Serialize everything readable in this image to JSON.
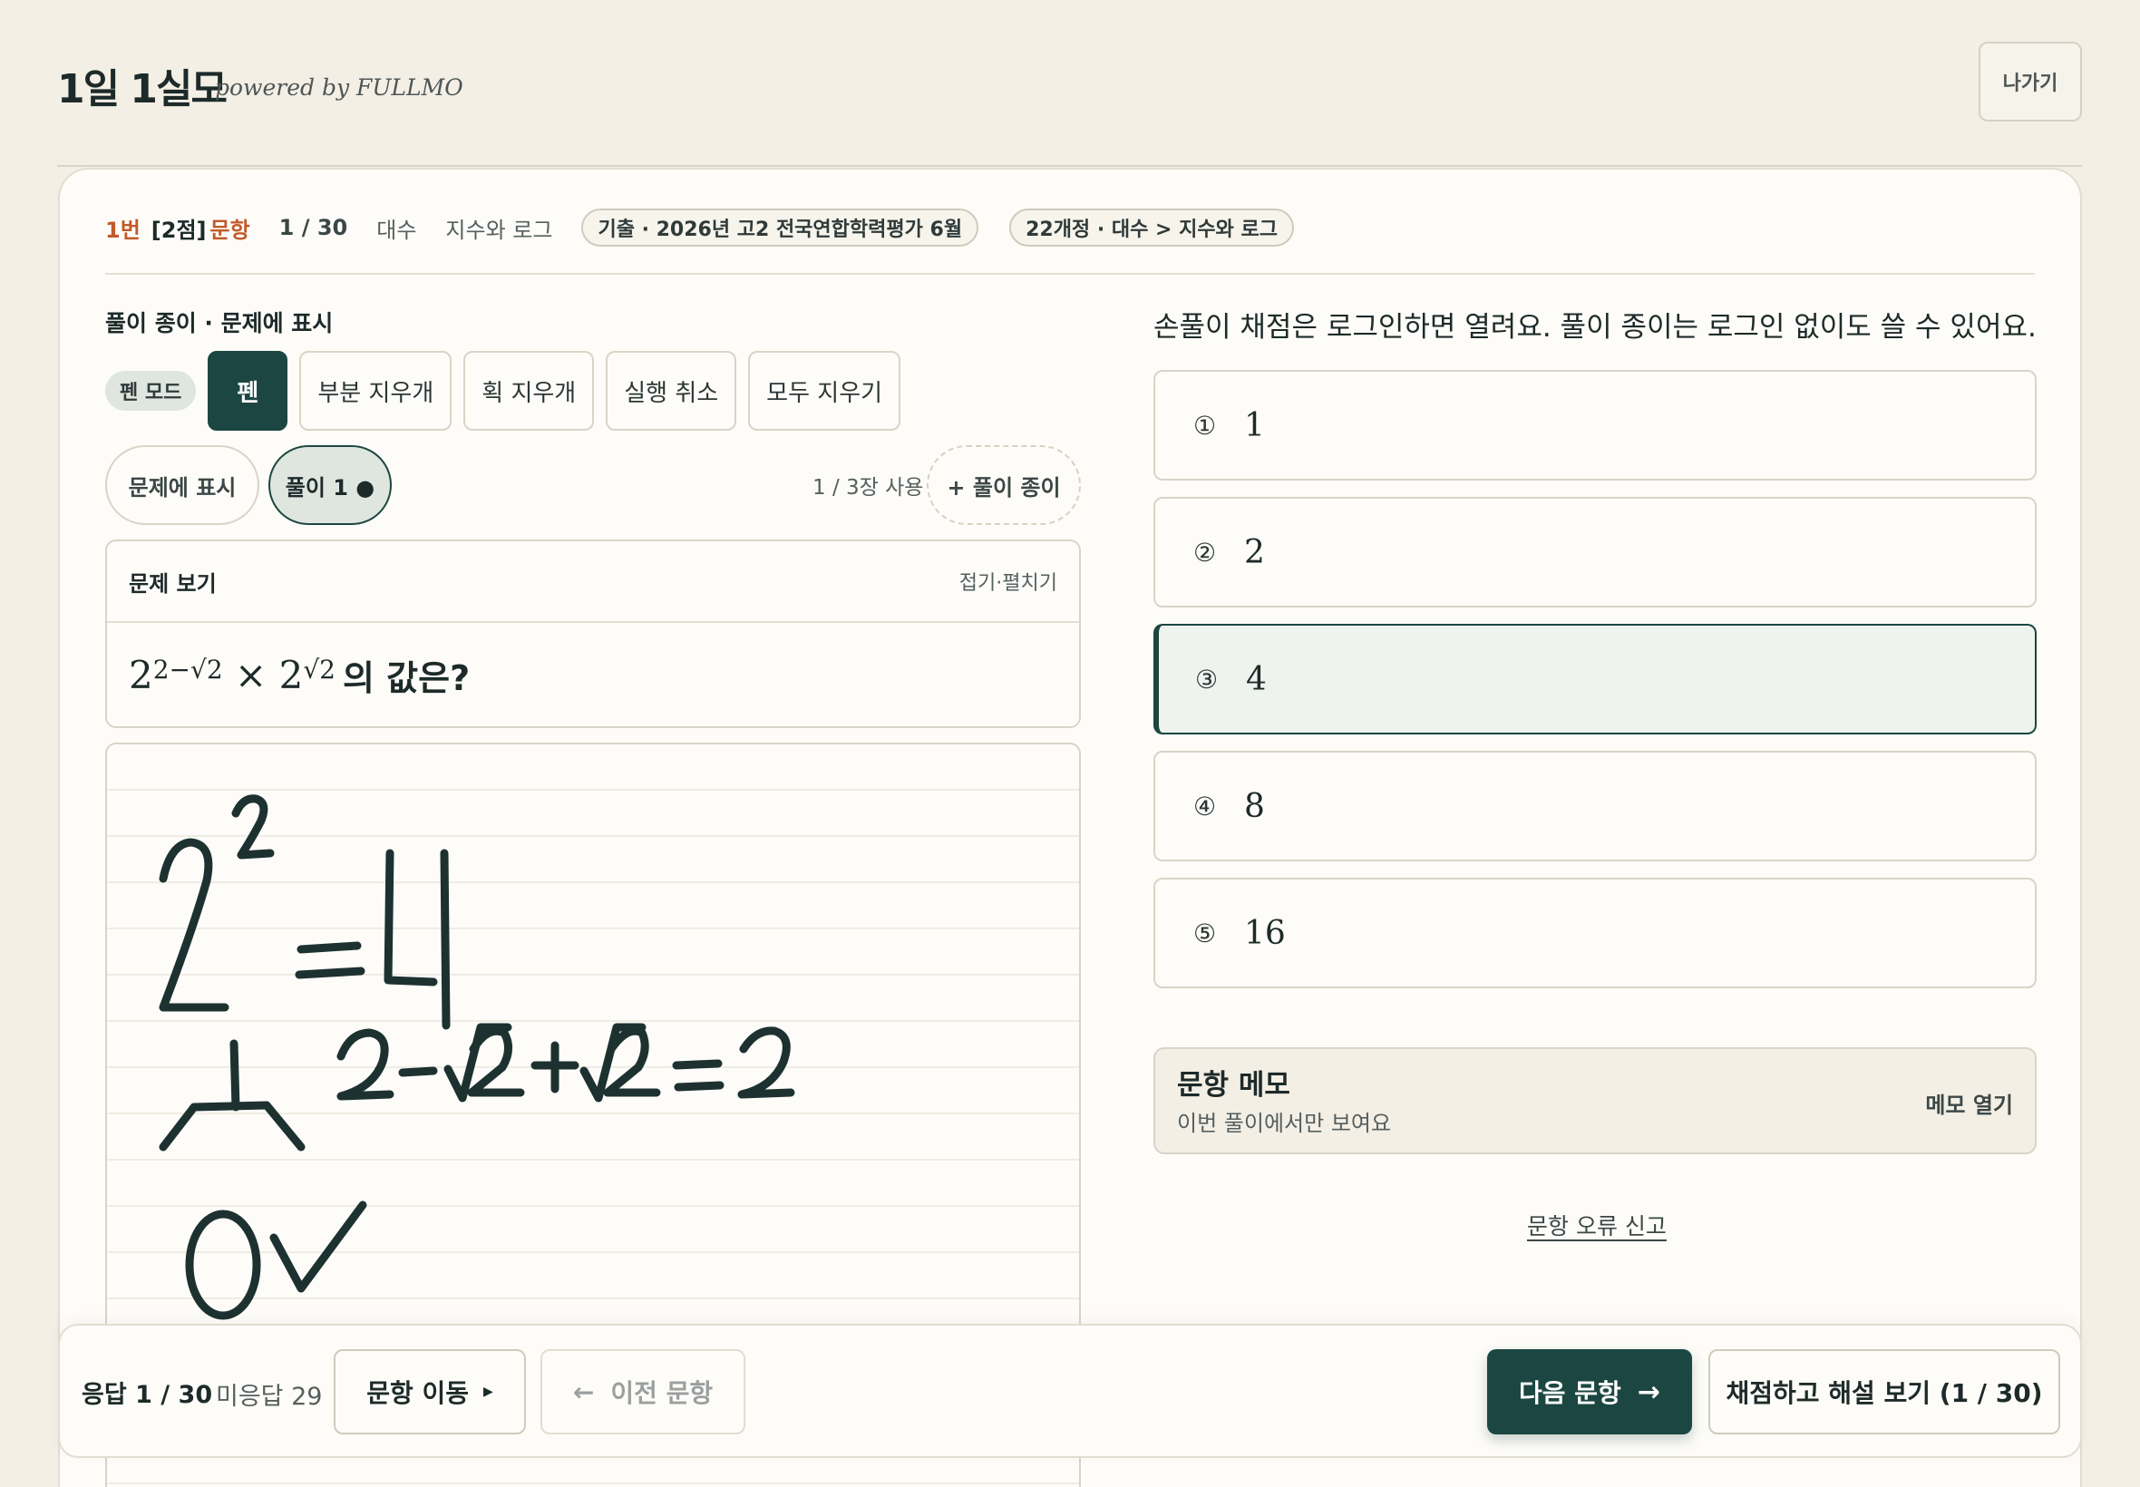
{
  "header": {
    "title": "1일 1실모",
    "powered_by": "powered by FULLMO",
    "exit_label": "나가기"
  },
  "question_meta": {
    "number": "1번",
    "points": "[2점]",
    "kind": "문항",
    "count": "1 / 30",
    "subject": "대수",
    "unit": "지수와 로그",
    "source_chip": "기출 · 2026년 고2 전국연합학력평가 6월",
    "curriculum_chip": "22개정 · 대수 > 지수와 로그"
  },
  "paper": {
    "title": "풀이 종이 · 문제에 표시",
    "pen_mode_label": "펜 모드",
    "tools": {
      "pen": "펜",
      "partial_eraser": "부분 지우개",
      "stroke_eraser": "획 지우개",
      "undo": "실행 취소",
      "clear_all": "모두 지우기"
    },
    "sheet_show_on_problem": "문제에 표시",
    "sheet_solution": "풀이 1 ●",
    "sheet_usage": "1 / 3장 사용",
    "add_sheet": "+ 풀이 종이"
  },
  "problem": {
    "header": "문제 보기",
    "toggle": "접기·펼치기",
    "base1": "2",
    "exp1": "2−√2",
    "times": " × ",
    "base2": "2",
    "exp2": "√2",
    "suffix": "의 값은?"
  },
  "right_panel": {
    "login_note": "손풀이 채점은 로그인하면 열려요. 풀이 종이는 로그인 없이도 쓸 수 있어요."
  },
  "options": [
    {
      "mark": "①",
      "value": "1"
    },
    {
      "mark": "②",
      "value": "2"
    },
    {
      "mark": "③",
      "value": "4"
    },
    {
      "mark": "④",
      "value": "8"
    },
    {
      "mark": "⑤",
      "value": "16"
    }
  ],
  "memo": {
    "title": "문항 메모",
    "subtitle": "이번 풀이에서만 보여요",
    "open_label": "메모 열기"
  },
  "report_label": "문항 오류 신고",
  "bottom": {
    "answered": "응답 1 / 30",
    "unanswered": "미응답 29",
    "move_label": "문항 이동",
    "prev_label": "이전 문항",
    "next_label": "다음 문항",
    "grade_label": "채점하고 해설 보기 (1 / 30)"
  },
  "colors": {
    "background": "#f3efe5",
    "accent": "#1c4641",
    "highlight": "#c15a2b"
  }
}
